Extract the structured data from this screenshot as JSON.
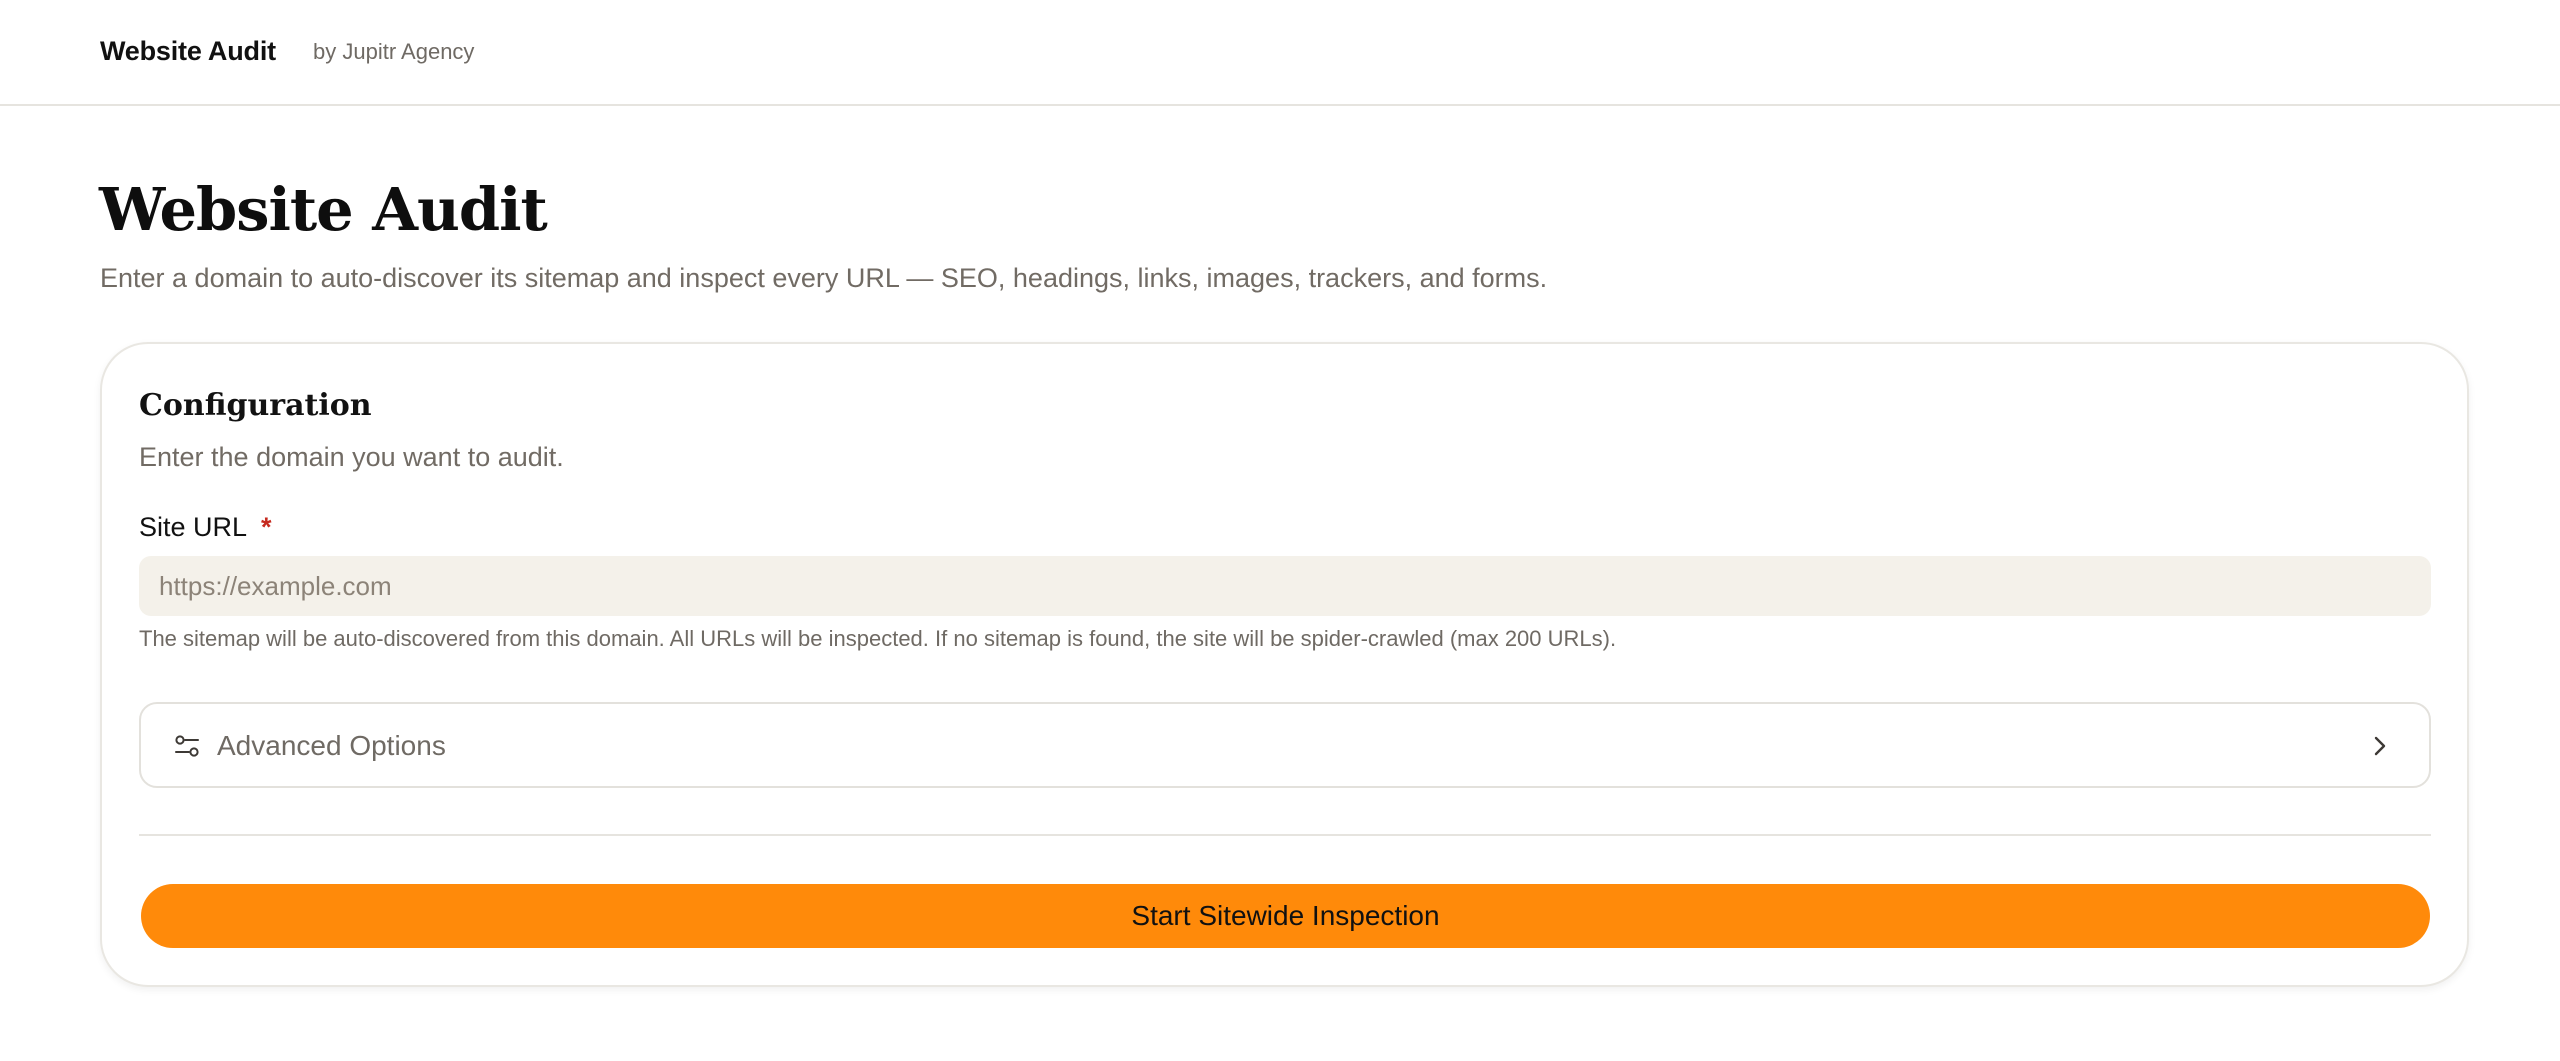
{
  "header": {
    "brand": "Website Audit",
    "brand_sub": "by Jupitr Agency"
  },
  "page": {
    "title": "Website Audit",
    "subtitle": "Enter a domain to auto-discover its sitemap and inspect every URL — SEO, headings, links, images, trackers, and forms."
  },
  "config": {
    "title": "Configuration",
    "description": "Enter the domain you want to audit.",
    "site_url": {
      "label": "Site URL",
      "required_mark": "*",
      "placeholder": "https://example.com",
      "value": "",
      "help": "The sitemap will be auto-discovered from this domain. All URLs will be inspected. If no sitemap is found, the site will be spider-crawled (max 200 URLs)."
    },
    "advanced": {
      "label": "Advanced Options",
      "icon": "sliders-icon",
      "chevron": "chevron-right-icon",
      "expanded": false
    },
    "start_button": {
      "label": "Start Sitewide Inspection"
    }
  },
  "colors": {
    "accent": "#ff8a0a",
    "input_bg": "#f4f1ea",
    "muted_text": "#716b64",
    "required": "#c62a1f"
  }
}
